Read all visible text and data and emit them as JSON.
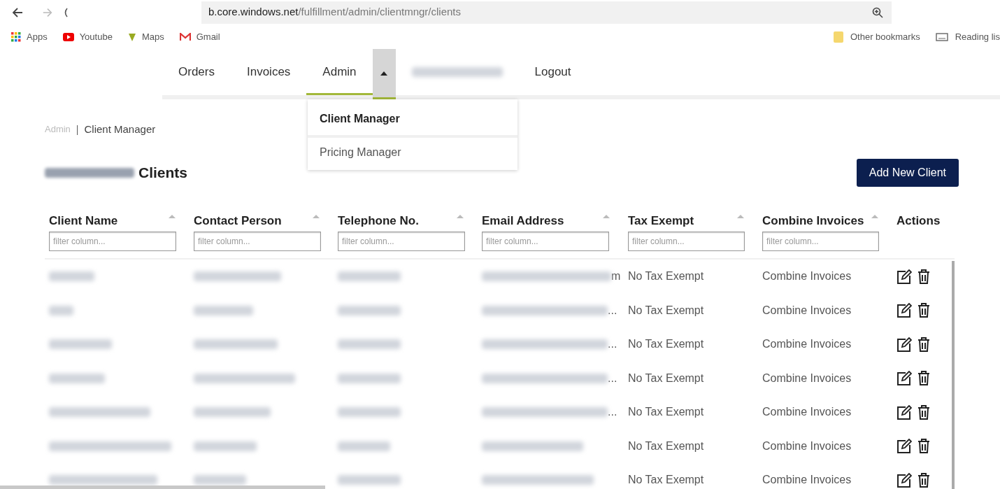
{
  "browser": {
    "url_host": "b.core.windows.net",
    "url_path": "/fulfillment/admin/clientmngr/clients",
    "bookmarks": [
      {
        "label": "Apps"
      },
      {
        "label": "Youtube"
      },
      {
        "label": "Maps"
      },
      {
        "label": "Gmail"
      }
    ],
    "bookmarks_right": [
      {
        "label": "Other bookmarks"
      },
      {
        "label": "Reading lis"
      }
    ]
  },
  "nav": {
    "items": [
      {
        "kind": "link",
        "label": "Orders",
        "selected": false
      },
      {
        "kind": "link",
        "label": "Invoices",
        "selected": false
      },
      {
        "kind": "link",
        "label": "Admin",
        "selected": true
      },
      {
        "kind": "toggle",
        "expanded": true
      },
      {
        "kind": "redacted"
      },
      {
        "kind": "link",
        "label": "Logout",
        "selected": false
      }
    ],
    "menu": [
      {
        "label": "Client Manager",
        "selected": true
      },
      {
        "label": "Pricing Manager",
        "selected": false
      }
    ]
  },
  "breadcrumb": [
    {
      "label": "Admin",
      "current": false
    },
    {
      "label": "Client Manager",
      "current": true
    }
  ],
  "separator": "|",
  "title": "Clients",
  "add_button": "Add New Client",
  "table": {
    "columns": [
      {
        "label": "Client Name",
        "filter_placeholder": "filter column..."
      },
      {
        "label": "Contact Person",
        "filter_placeholder": "filter column..."
      },
      {
        "label": "Telephone No.",
        "filter_placeholder": "filter column..."
      },
      {
        "label": "Email Address",
        "filter_placeholder": "filter column..."
      },
      {
        "label": "Tax Exempt",
        "filter_placeholder": "filter column..."
      },
      {
        "label": "Combine Invoices",
        "filter_placeholder": "filter column..."
      },
      {
        "label": "Actions"
      }
    ],
    "rows": [
      {
        "cells": [
          {
            "kind": "redacted"
          },
          {
            "kind": "redacted"
          },
          {
            "kind": "redacted"
          },
          {
            "kind": "redacted",
            "suffix": "m"
          },
          {
            "kind": "text",
            "text": "No Tax Exempt"
          },
          {
            "kind": "text",
            "text": "Combine Invoices"
          }
        ]
      },
      {
        "cells": [
          {
            "kind": "redacted"
          },
          {
            "kind": "redacted"
          },
          {
            "kind": "redacted"
          },
          {
            "kind": "redacted",
            "suffix": "..."
          },
          {
            "kind": "text",
            "text": "No Tax Exempt"
          },
          {
            "kind": "text",
            "text": "Combine Invoices"
          }
        ]
      },
      {
        "cells": [
          {
            "kind": "redacted"
          },
          {
            "kind": "redacted"
          },
          {
            "kind": "redacted"
          },
          {
            "kind": "redacted",
            "suffix": "..."
          },
          {
            "kind": "text",
            "text": "No Tax Exempt"
          },
          {
            "kind": "text",
            "text": "Combine Invoices"
          }
        ]
      },
      {
        "cells": [
          {
            "kind": "redacted"
          },
          {
            "kind": "redacted"
          },
          {
            "kind": "redacted"
          },
          {
            "kind": "redacted",
            "suffix": "..."
          },
          {
            "kind": "text",
            "text": "No Tax Exempt"
          },
          {
            "kind": "text",
            "text": "Combine Invoices"
          }
        ]
      },
      {
        "cells": [
          {
            "kind": "redacted"
          },
          {
            "kind": "redacted"
          },
          {
            "kind": "redacted"
          },
          {
            "kind": "redacted",
            "suffix": "..."
          },
          {
            "kind": "text",
            "text": "No Tax Exempt"
          },
          {
            "kind": "text",
            "text": "Combine Invoices"
          }
        ]
      },
      {
        "cells": [
          {
            "kind": "redacted"
          },
          {
            "kind": "redacted"
          },
          {
            "kind": "redacted"
          },
          {
            "kind": "redacted"
          },
          {
            "kind": "text",
            "text": "No Tax Exempt"
          },
          {
            "kind": "text",
            "text": "Combine Invoices"
          }
        ]
      },
      {
        "cells": [
          {
            "kind": "redacted"
          },
          {
            "kind": "redacted"
          },
          {
            "kind": "redacted"
          },
          {
            "kind": "redacted"
          },
          {
            "kind": "text",
            "text": "No Tax Exempt"
          },
          {
            "kind": "text",
            "text": "Combine Invoices"
          }
        ]
      }
    ]
  }
}
